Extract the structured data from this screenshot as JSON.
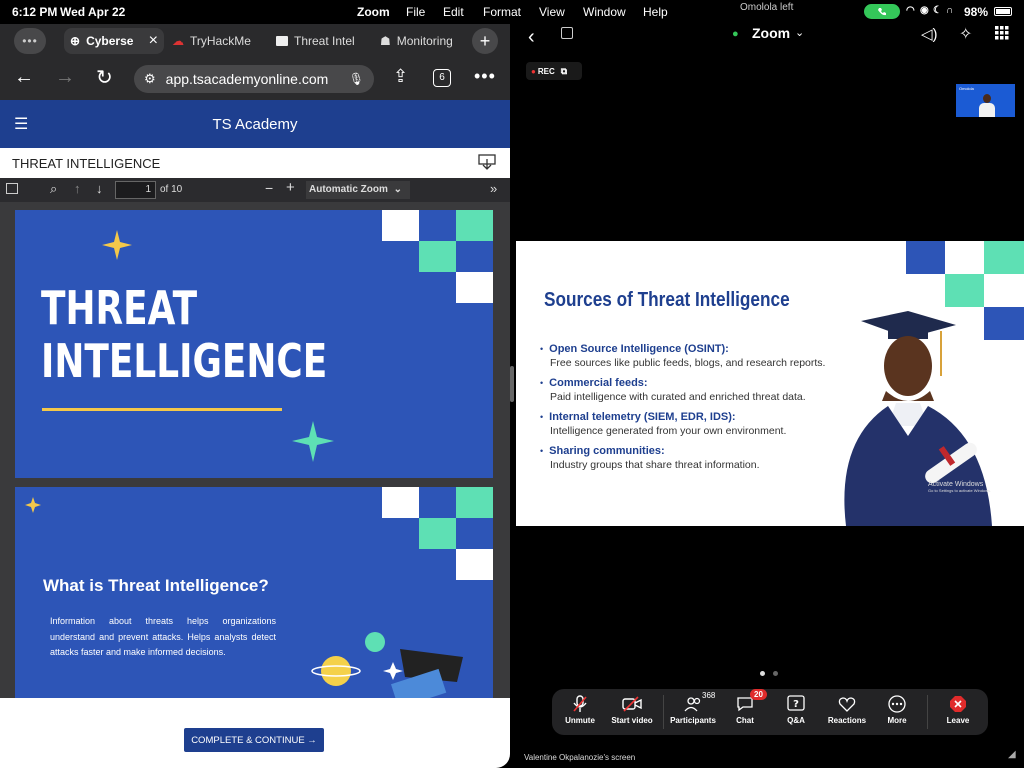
{
  "status": {
    "time": "6:12 PM",
    "date": "Wed Apr 22",
    "menu": [
      "Zoom",
      "File",
      "Edit",
      "Format",
      "View",
      "Window",
      "Help"
    ],
    "center_notice": "Omolola left",
    "battery": "98%"
  },
  "browser": {
    "tabs": [
      {
        "label": "Cyberse"
      },
      {
        "label": "TryHackMe"
      },
      {
        "label": "Threat Intel"
      },
      {
        "label": "Monitoring"
      }
    ],
    "url": "app.tsacademyonline.com",
    "tab_count": "6"
  },
  "site": {
    "title": "TS Academy",
    "section": "THREAT INTELLIGENCE"
  },
  "pdf": {
    "page": "1",
    "of_pages": "of 10",
    "zoom": "Automatic Zoom"
  },
  "slides": {
    "s1_line1": "THREAT",
    "s1_line2": "INTELLIGENCE",
    "s2_title": "What is Threat Intelligence?",
    "s2_body": "Information about threats helps organizations understand and prevent attacks. Helps analysts detect attacks faster and make informed decisions."
  },
  "footer": {
    "continue": "COMPLETE & CONTINUE →"
  },
  "zoom": {
    "meeting_label": "Zoom",
    "rec": "REC",
    "self_label": "Omolola",
    "shared_title": "Sources of Threat Intelligence",
    "bullets": [
      {
        "title": "Open Source Intelligence (OSINT):",
        "desc": "Free sources like public feeds, blogs, and research reports."
      },
      {
        "title": "Commercial feeds:",
        "desc": "Paid intelligence with curated and enriched threat data."
      },
      {
        "title": "Internal telemetry (SIEM, EDR, IDS):",
        "desc": "Intelligence generated from your own environment."
      },
      {
        "title": "Sharing communities:",
        "desc": "Industry groups that share threat information."
      }
    ],
    "watermark": "Activate Windows",
    "watermark2": "Go to Settings to activate Windows.",
    "controls": {
      "unmute": "Unmute",
      "video": "Start video",
      "participants": "Participants",
      "participants_count": "368",
      "chat": "Chat",
      "chat_count": "20",
      "qa": "Q&A",
      "reactions": "Reactions",
      "more": "More",
      "leave": "Leave"
    },
    "screen_owner": "Valentine Okpalanozie's screen"
  },
  "colors": {
    "accent_blue": "#2d55b7",
    "header_blue": "#1e3f8f",
    "teal": "#5ee0b4",
    "yellow": "#f4c84a"
  }
}
